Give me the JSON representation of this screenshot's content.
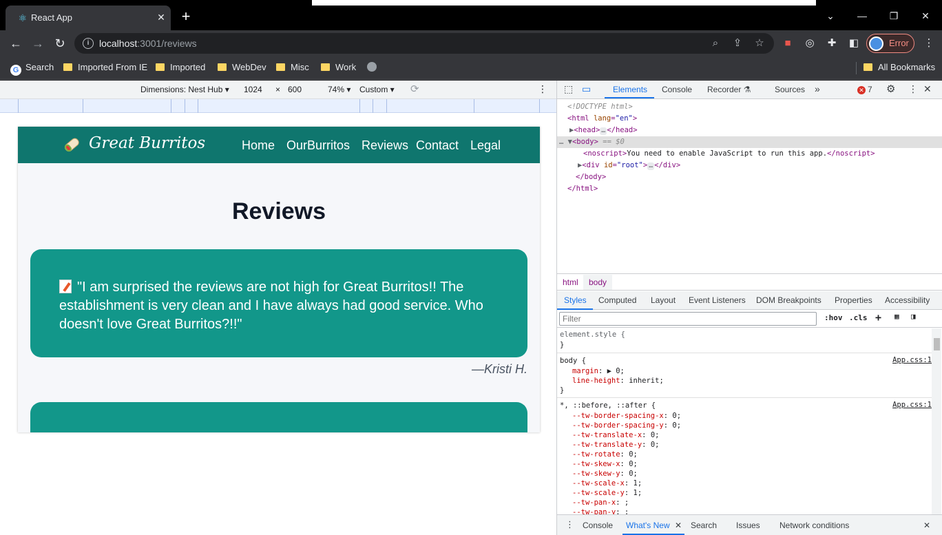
{
  "browser": {
    "tab_title": "React App",
    "tab_close": "✕",
    "new_tab": "+",
    "url_host": "localhost",
    "url_rest": ":3001/reviews",
    "profile_label": "Error",
    "window_controls": [
      "⌄",
      "—",
      "❐",
      "✕"
    ]
  },
  "bookmarks": {
    "items": [
      "Search",
      "Imported From IE",
      "Imported",
      "WebDev",
      "Misc",
      "Work"
    ],
    "all": "All Bookmarks"
  },
  "device_toolbar": {
    "dimensions_label": "Dimensions: Nest Hub",
    "width": "1024",
    "times": "×",
    "height": "600",
    "zoom": "74%",
    "throttle": "Custom"
  },
  "site": {
    "brand": "Great Burritos",
    "nav": [
      "Home",
      "OurBurritos",
      "Reviews",
      "Contact",
      "Legal"
    ],
    "heading": "Reviews",
    "review_text": "\"I am surprised the reviews are not high for Great Burritos!! The establishment is very clean and I have always had good service. Who doesn't love Great Burritos?!!\"",
    "review_author": "—Kristi H.",
    "colors": {
      "nav": "#0f766e",
      "card": "#12978a"
    }
  },
  "devtools": {
    "tabs": [
      "Elements",
      "Console",
      "Recorder",
      "Sources"
    ],
    "error_count": "7",
    "dom": {
      "doctype": "<!DOCTYPE html>",
      "html_open_tag": "html",
      "html_attr": "lang",
      "html_val": "\"en\"",
      "head": "head",
      "body": "body",
      "body_marker": "== $0",
      "noscript_text": "You need to enable JavaScript to run this app.",
      "div_attr": "id",
      "div_val": "\"root\""
    },
    "crumbs": [
      "html",
      "body"
    ],
    "sub_tabs": [
      "Styles",
      "Computed",
      "Layout",
      "Event Listeners",
      "DOM Breakpoints",
      "Properties",
      "Accessibility"
    ],
    "filter_placeholder": "Filter",
    "filter_buttons": [
      ":hov",
      ".cls"
    ],
    "styles": {
      "element_style": "element.style {",
      "close": "}",
      "body_selector": "body {",
      "body_src": "App.css:1",
      "body_props": [
        {
          "name": "margin",
          "value": "▶ 0;"
        },
        {
          "name": "line-height",
          "value": "inherit;"
        }
      ],
      "universal_selector": "*, ::before, ::after {",
      "universal_src": "App.css:1",
      "universal_props": [
        {
          "name": "--tw-border-spacing-x",
          "value": "0;"
        },
        {
          "name": "--tw-border-spacing-y",
          "value": "0;"
        },
        {
          "name": "--tw-translate-x",
          "value": "0;"
        },
        {
          "name": "--tw-translate-y",
          "value": "0;"
        },
        {
          "name": "--tw-rotate",
          "value": "0;"
        },
        {
          "name": "--tw-skew-x",
          "value": "0;"
        },
        {
          "name": "--tw-skew-y",
          "value": "0;"
        },
        {
          "name": "--tw-scale-x",
          "value": "1;"
        },
        {
          "name": "--tw-scale-y",
          "value": "1;"
        },
        {
          "name": "--tw-pan-x",
          "value": ";"
        },
        {
          "name": "--tw-pan-y",
          "value": ";"
        }
      ]
    },
    "drawer_tabs": [
      "Console",
      "What's New",
      "Search",
      "Issues",
      "Network conditions"
    ]
  }
}
